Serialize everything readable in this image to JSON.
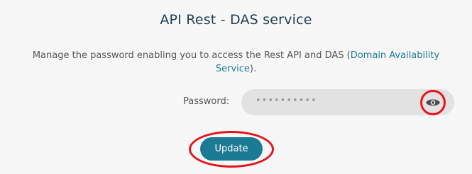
{
  "header": {
    "title": "API Rest - DAS service"
  },
  "description": {
    "text_before": "Manage the password enabling you to access the Rest API and DAS (",
    "link_text": "Domain Availability Service",
    "text_after": ")."
  },
  "password": {
    "label": "Password:",
    "masked_value": "••••••••••",
    "toggle_icon": "eye-icon"
  },
  "actions": {
    "update_label": "Update"
  },
  "colors": {
    "accent": "#1b7a94",
    "title": "#1f3f55",
    "highlight": "#e5141b",
    "field_bg": "#e2e2e2"
  }
}
